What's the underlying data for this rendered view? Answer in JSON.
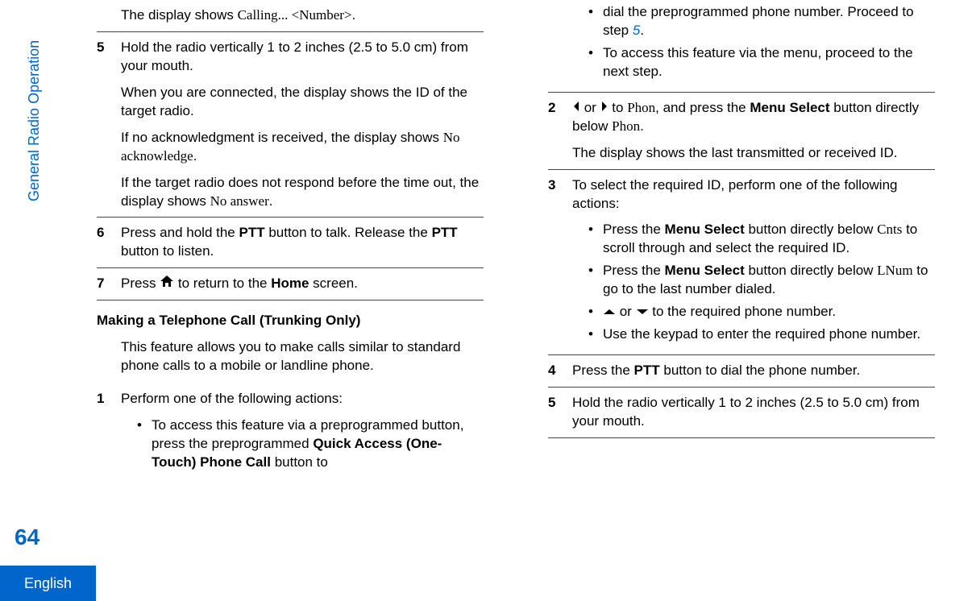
{
  "side": {
    "label": "General Radio Operation",
    "page_number": "64",
    "lang": "English"
  },
  "left": {
    "cont": {
      "l1a": "The display shows ",
      "l1b": "Calling... <Number>",
      "l1c": "."
    },
    "s5": {
      "n": "5",
      "p1": "Hold the radio vertically 1 to 2 inches (2.5 to 5.0 cm) from your mouth.",
      "p2": "When you are connected, the display shows the ID of the target radio.",
      "p3a": "If no acknowledgment is received, the display shows ",
      "p3b": "No acknowledge",
      "p3c": ".",
      "p4a": "If the target radio does not respond before the time out, the display shows ",
      "p4b": "No answer",
      "p4c": "."
    },
    "s6": {
      "n": "6",
      "t1": "Press and hold the ",
      "t2": "PTT",
      "t3": " button to talk. Release the ",
      "t4": "PTT",
      "t5": " button to listen."
    },
    "s7": {
      "n": "7",
      "t1": "Press ",
      "t2": " to return to the ",
      "t3": "Home",
      "t4": " screen."
    },
    "heading": "Making a Telephone Call (Trunking Only)",
    "intro": "This feature allows you to make calls similar to standard phone calls to a mobile or landline phone.",
    "s1": {
      "n": "1",
      "t": "Perform one of the following actions:",
      "b1a": "To access this feature via a preprogrammed button, press the preprogrammed ",
      "b1b": "Quick Access (One-Touch) Phone Call",
      "b1c": " button to"
    }
  },
  "right": {
    "cont": {
      "l1a": "dial the preprogrammed phone number. Proceed to step ",
      "l1b": "5",
      "l1c": ".",
      "b2": "To access this feature via the menu, proceed to the next step."
    },
    "s2": {
      "n": "2",
      "t1": " or ",
      "t2": " to ",
      "t3": "Phon",
      "t4": ", and press the ",
      "t5": "Menu Select",
      "t6": " button directly below ",
      "t7": "Phon",
      "t8": ".",
      "p2": "The display shows the last transmitted or received ID."
    },
    "s3": {
      "n": "3",
      "t": "To select the required ID, perform one of the following actions:",
      "b1a": "Press the ",
      "b1b": "Menu Select",
      "b1c": " button directly below ",
      "b1d": "Cnts",
      "b1e": " to scroll through and select the required ID.",
      "b2a": "Press the ",
      "b2b": "Menu Select",
      "b2c": " button directly below ",
      "b2d": "LNum",
      "b2e": " to go to the last number dialed.",
      "b3a": " or ",
      "b3b": " to the required phone number.",
      "b4": "Use the keypad to enter the required phone number."
    },
    "s4": {
      "n": "4",
      "t1": "Press the ",
      "t2": "PTT",
      "t3": " button to dial the phone number."
    },
    "s5": {
      "n": "5",
      "t": "Hold the radio vertically 1 to 2 inches (2.5 to 5.0 cm) from your mouth."
    }
  }
}
